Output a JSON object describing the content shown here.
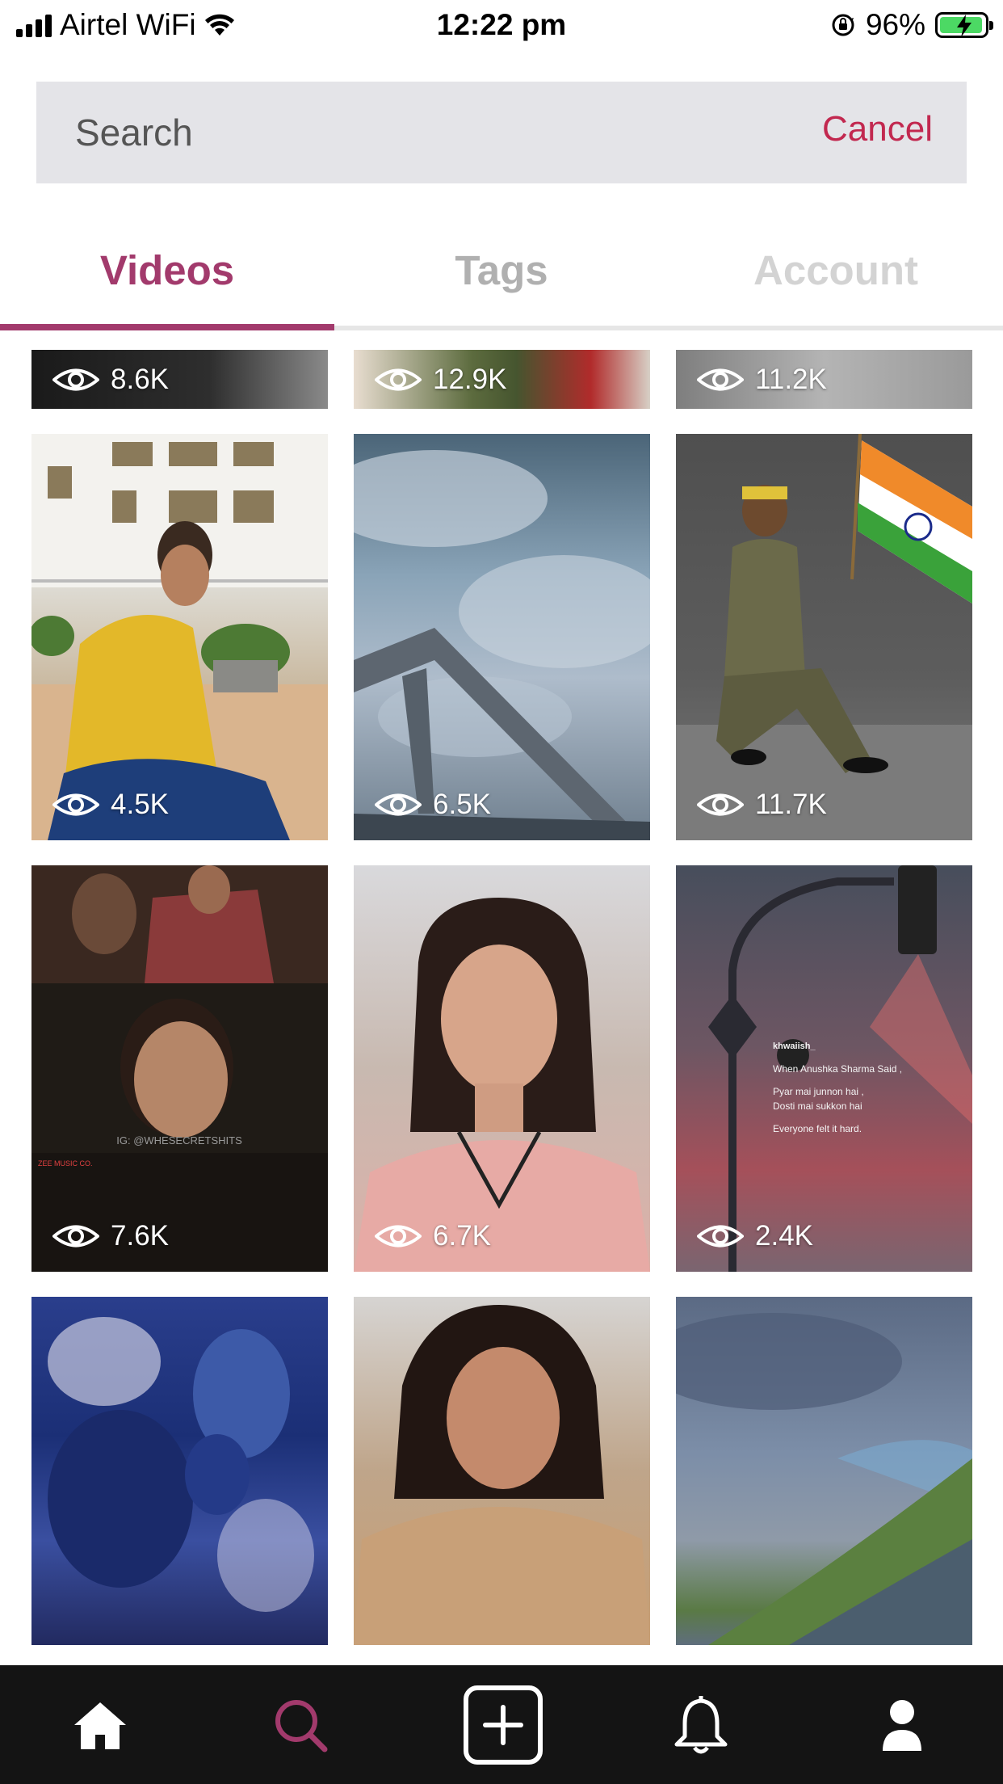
{
  "status_bar": {
    "carrier": "Airtel WiFi",
    "time": "12:22 pm",
    "battery": "96%",
    "battery_level": 0.96
  },
  "search": {
    "placeholder": "Search",
    "value": "",
    "cancel_label": "Cancel"
  },
  "tabs": [
    {
      "label": "Videos",
      "selected": true
    },
    {
      "label": "Tags",
      "selected": false
    },
    {
      "label": "Account",
      "selected": false
    }
  ],
  "videos": [
    {
      "views": "8.6K"
    },
    {
      "views": "12.9K"
    },
    {
      "views": "11.2K"
    },
    {
      "views": "4.5K"
    },
    {
      "views": "6.5K"
    },
    {
      "views": "11.7K"
    },
    {
      "views": "7.6K"
    },
    {
      "views": "6.7K"
    },
    {
      "views": "2.4K"
    },
    {
      "views": ""
    },
    {
      "views": ""
    },
    {
      "views": ""
    }
  ],
  "tile_text": {
    "tweet_handle": "khwaiish_",
    "tweet_line1": "When Anushka Sharma Said ,",
    "tweet_line2": "Pyar mai junnon hai ,",
    "tweet_line3": "Dosti mai sukkon hai",
    "tweet_line4": "Everyone felt it hard.",
    "caption": "IG: @WHESECRETSHITS",
    "logo": "ZEE MUSIC CO."
  },
  "nav": {
    "items": [
      "home-icon",
      "search-icon",
      "add-icon",
      "bell-icon",
      "profile-icon"
    ],
    "active": "search-icon"
  },
  "colors": {
    "accent": "#a23a6c",
    "cancel": "#c2284f",
    "nav_bg": "#141414"
  }
}
